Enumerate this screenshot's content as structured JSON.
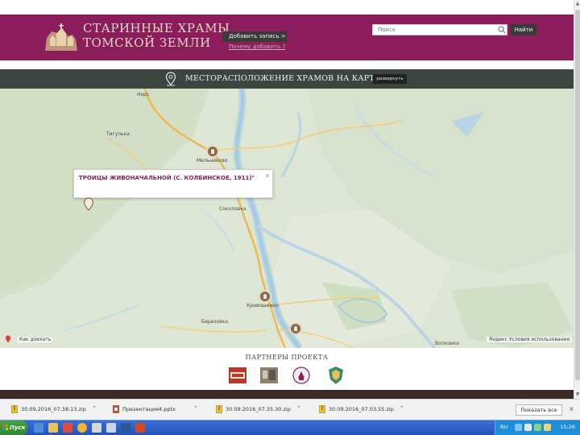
{
  "header": {
    "logo_line1": "СТАРИННЫЕ ХРАМЫ",
    "logo_line2": "ТОМСКОЙ ЗЕМЛИ",
    "add_record_label": "Добавить запись >",
    "how_to_add_label": "Почему добавить ?",
    "search_placeholder": "Поиск",
    "search_button_label": "Найти",
    "brand_color": "#8b1d5c"
  },
  "map_bar": {
    "title": "МЕСТОРАСПОЛОЖЕНИЕ ХРАМОВ НА КАРТЕ",
    "button_label": "развернуть"
  },
  "map": {
    "places": {
      "nors": "Норс",
      "tigulka": "Тигулька",
      "molchanovo": "Мельниково",
      "sokolovka": "Соколовка",
      "krivosheino": "Кривошеино",
      "volkovka": "Волковка",
      "berezovka": "Березовка"
    },
    "popup_text": "ТРОИЦЫ ЖИВОНАЧАЛЬНОЙ (С. КОЛБИНСКОЕ, 1911)\"",
    "popup_close": "x",
    "corner_link": "Как доехать",
    "credit": "Яндекс  Условия использования"
  },
  "partners": {
    "title": "ПАРТНЕРЫ ПРОЕКТА",
    "logos": [
      "partner-logo-tuze",
      "partner-logo-photo",
      "partner-logo-seal",
      "partner-logo-emblem"
    ]
  },
  "downloads": {
    "items": [
      {
        "name": "30.09.2016_07.38.13.zip",
        "icon": "zip-icon"
      },
      {
        "name": "Презентация4.pptx",
        "icon": "pptx-icon"
      },
      {
        "name": "30.09.2016_07.35.30.zip",
        "icon": "zip-icon"
      },
      {
        "name": "30.09.2016_07.03.55.zip",
        "icon": "zip-icon"
      }
    ],
    "show_all_label": "Показать все",
    "close_label": "×"
  },
  "taskbar": {
    "start_label": "Пуск",
    "language": "RU",
    "clock": "15:26"
  }
}
